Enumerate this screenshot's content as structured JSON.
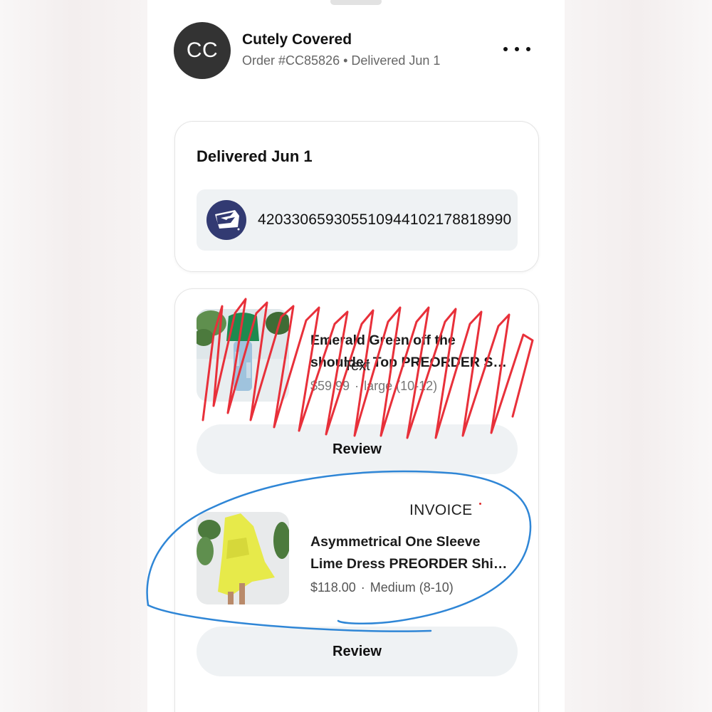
{
  "header": {
    "avatar_initials": "CC",
    "shop_name": "Cutely Covered",
    "order_subtitle": "Order #CC85826 • Delivered Jun 1",
    "more_icon": "more-horizontal-icon"
  },
  "delivery": {
    "title": "Delivered Jun 1",
    "carrier_icon": "usps-eagle-icon",
    "tracking_number": "420330659305510944102178818990"
  },
  "items": [
    {
      "title_line1": "Emerald Green off the",
      "title_line2": "shoulder Top PREORDER S…",
      "price": "$59.99",
      "separator": "·",
      "size": "large (10-12)",
      "review_label": "Review"
    },
    {
      "title_line1": "Asymmetrical One Sleeve",
      "title_line2": "Lime Dress PREORDER Shi…",
      "price": "$118.00",
      "separator": "·",
      "size": "Medium (8-10)",
      "review_label": "Review"
    }
  ],
  "annotations": {
    "scribble_text": "Text",
    "invoice_label": "INVOICE",
    "scribble_color": "#e8303a",
    "circle_color": "#2f86d6"
  },
  "colors": {
    "avatar_bg": "#333333",
    "usps_blue": "#323a72",
    "button_bg": "#eff2f4"
  }
}
